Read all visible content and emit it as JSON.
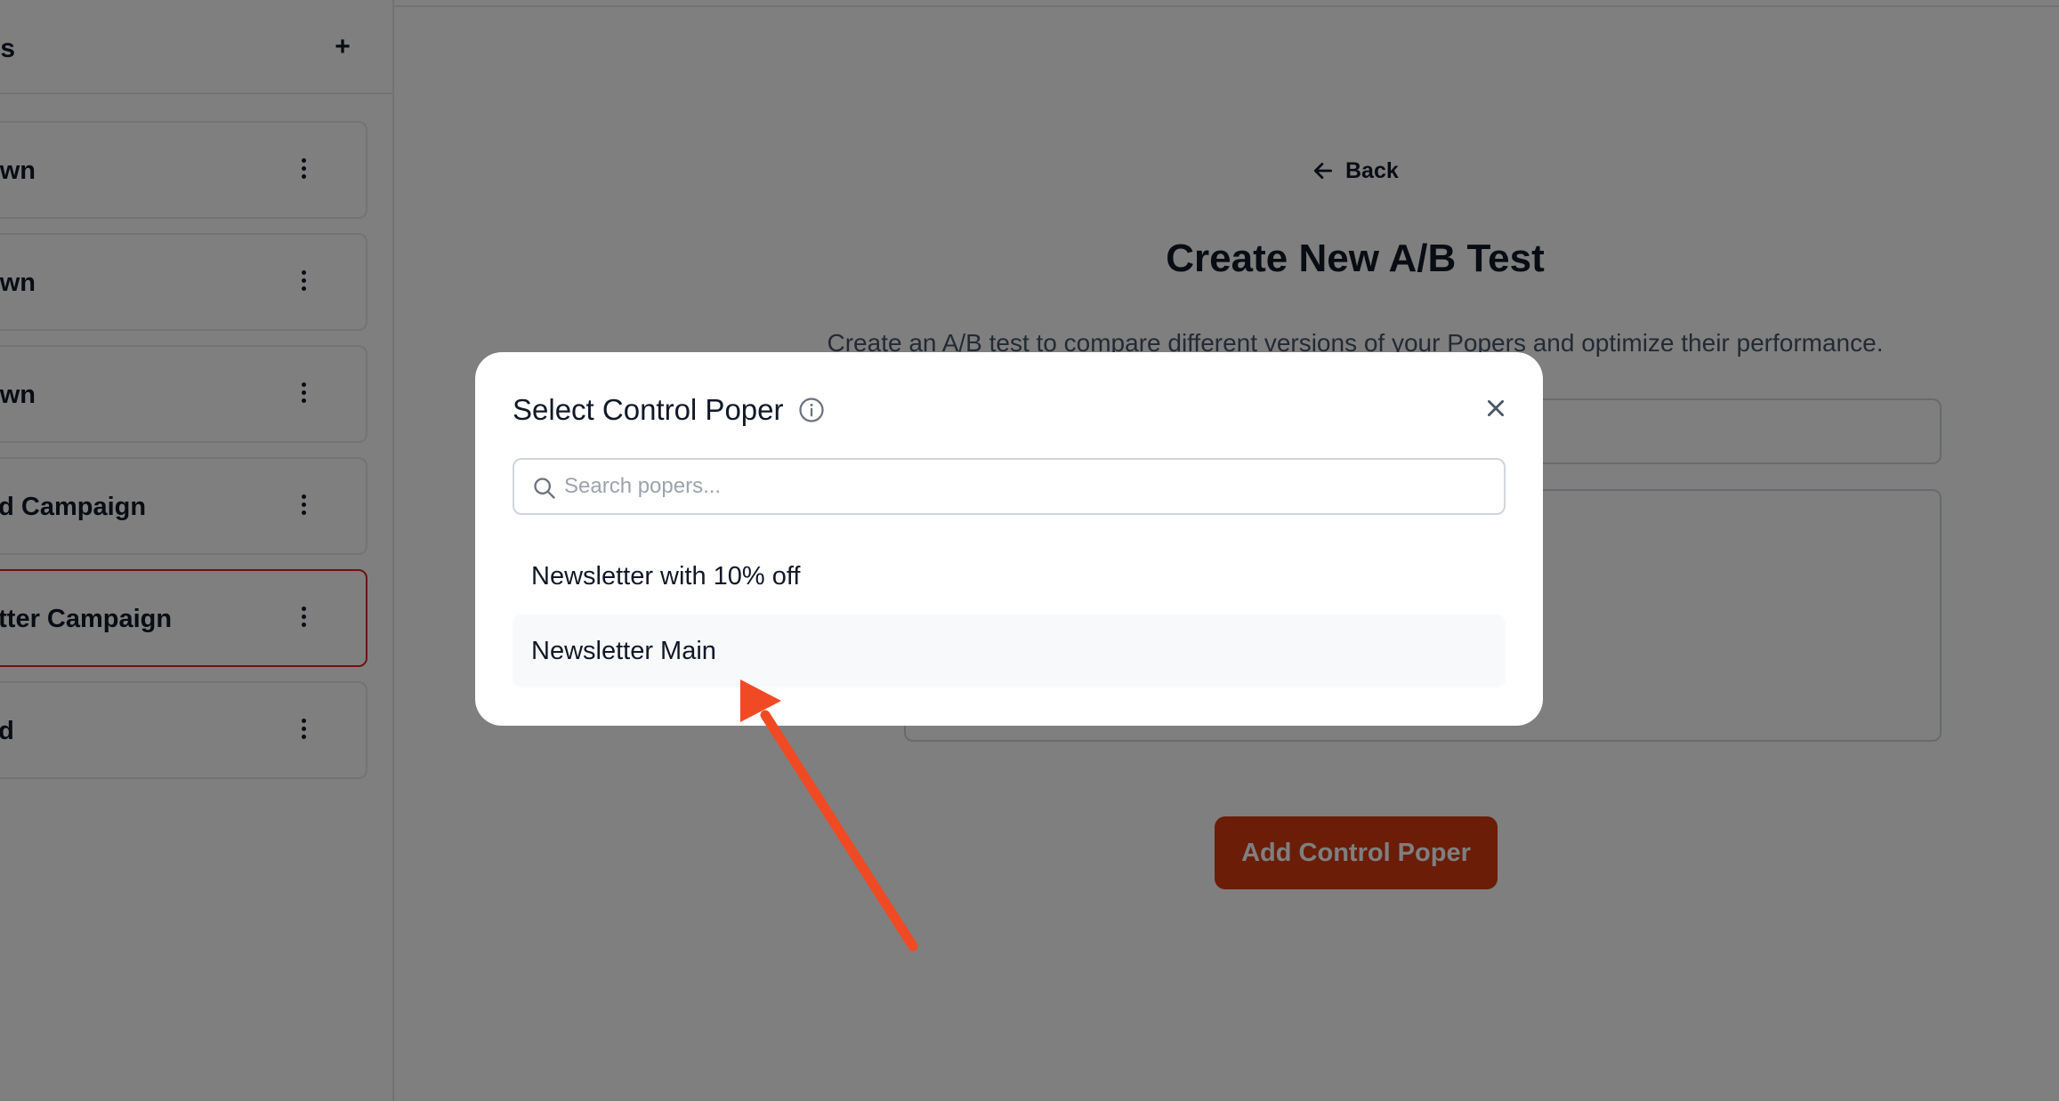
{
  "sidebar": {
    "title": "ns",
    "add_icon": "plus-icon",
    "items": [
      {
        "label": "own"
      },
      {
        "label": "own"
      },
      {
        "label": "own"
      },
      {
        "label": "ed Campaign"
      },
      {
        "label": "etter Campaign",
        "selected": true
      },
      {
        "label": "ed"
      }
    ],
    "item_menu_icon": "kebab-menu-icon"
  },
  "main": {
    "back_label": "Back",
    "title": "Create New A/B Test",
    "subtitle": "Create an A/B test to compare different versions of your Popers and optimize their performance.",
    "add_control_button": "Add Control Poper"
  },
  "modal": {
    "title": "Select Control Poper",
    "info_icon": "info-icon",
    "close_icon": "close-icon",
    "search": {
      "placeholder": "Search popers...",
      "value": ""
    },
    "options": [
      {
        "label": "Newsletter with 10% off"
      },
      {
        "label": "Newsletter Main",
        "hovered": true
      }
    ]
  },
  "colors": {
    "accent": "#d63a10",
    "selected_border": "#dc2626",
    "annotation_arrow": "#f04a24",
    "overlay": "rgba(0,0,0,0.5)"
  }
}
